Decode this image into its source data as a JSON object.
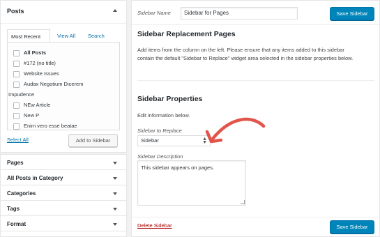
{
  "posts_panel": {
    "title": "Posts",
    "tabs": [
      "Most Recent",
      "View All",
      "Search"
    ],
    "items": [
      {
        "label": "All Posts",
        "bold": true,
        "checkbox": true
      },
      {
        "label": "#172 (no title)",
        "bold": false,
        "checkbox": true
      },
      {
        "label": "Website Issues",
        "bold": false,
        "checkbox": true
      },
      {
        "label": "Audax Negotium Dicerem",
        "bold": false,
        "checkbox": true
      },
      {
        "label": "Impudence",
        "bold": false,
        "checkbox": false
      },
      {
        "label": "NEw Article",
        "bold": false,
        "checkbox": true
      },
      {
        "label": "New P",
        "bold": false,
        "checkbox": true
      },
      {
        "label": "Enim vero esse beatae",
        "bold": false,
        "checkbox": true
      }
    ],
    "select_all": "Select All",
    "add_button": "Add to Sidebar"
  },
  "accordion": [
    "Pages",
    "All Posts in Category",
    "Categories",
    "Tags",
    "Format"
  ],
  "editor": {
    "name_label": "Sidebar Name",
    "name_value": "Sidebar for Pages",
    "save_label": "Save Sidebar",
    "replacement_title": "Sidebar Replacement Pages",
    "replacement_desc": "Add items from the column on the left. Please ensure that any items added to this sidebar contain the default \"Sidebar to Replace\" widget area selected in the sidebar properties below.",
    "properties_title": "Sidebar Properties",
    "edit_info": "Edit information below.",
    "replace_label": "Sidebar to Replace",
    "replace_value": "Sidebar",
    "description_label": "Sidebar Description",
    "description_value": "This sidebar appears on pages.",
    "delete_label": "Delete Sidebar"
  },
  "colors": {
    "primary": "#0085ba",
    "link": "#0073aa",
    "danger": "#a00000",
    "annotation": "#e2554b"
  }
}
